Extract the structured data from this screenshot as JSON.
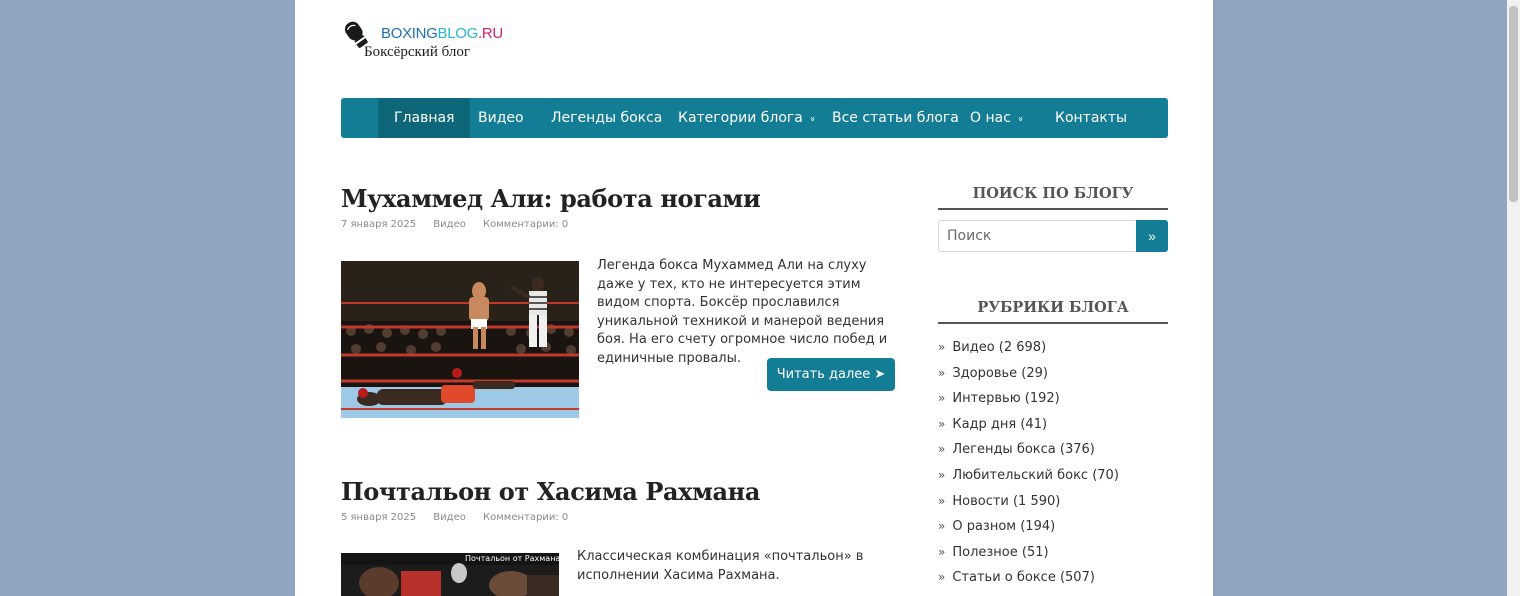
{
  "logo": {
    "brand_part1": "BOXING",
    "brand_part2": "BLOG",
    "brand_part3": ".RU",
    "tagline": "Боксёрский блог"
  },
  "nav": {
    "items": [
      {
        "label": "Главная",
        "active": true
      },
      {
        "label": "Видео"
      },
      {
        "label": "Легенды бокса"
      },
      {
        "label": "Категории блога",
        "dropdown": true
      },
      {
        "label": "Все статьи блога"
      },
      {
        "label": "О нас",
        "dropdown": true
      },
      {
        "label": "Контакты"
      }
    ],
    "chevron": "»"
  },
  "posts": [
    {
      "title": "Мухаммед Али: работа ногами",
      "date": "7 января 2025",
      "category": "Видео",
      "comments": "Комментарии: 0",
      "excerpt": "Легенда бокса Мухаммед Али на слуху даже у тех, кто не интересуется этим видом спорта. Боксёр прославился уникальной техникой и манерой ведения боя. На его счету огромное число побед и единичные провалы.",
      "read_more": "Читать далее ➤"
    },
    {
      "title": "Почтальон от Хасима Рахмана",
      "date": "5 января 2025",
      "category": "Видео",
      "comments": "Комментарии: 0",
      "excerpt": "Классическая комбинация «почтальон» в исполнении Хасима Рахмана.",
      "thumb_caption": "Почтальон от Рахмана"
    }
  ],
  "sidebar": {
    "search": {
      "title": "ПОИСК ПО БЛОГУ",
      "placeholder": "Поиск",
      "button": "»"
    },
    "categories": {
      "title": "РУБРИКИ БЛОГА",
      "bullet": "»",
      "items": [
        "Видео (2 698)",
        "Здоровье (29)",
        "Интервью (192)",
        "Кадр дня (41)",
        "Легенды бокса (376)",
        "Любительский бокс (70)",
        "Новости (1 590)",
        "О разном (194)",
        "Полезное (51)",
        "Статьи о боксе (507)"
      ]
    }
  },
  "colors": {
    "background": "#91a5c1",
    "accent": "#137d95",
    "accent_dark": "#0d6779"
  }
}
